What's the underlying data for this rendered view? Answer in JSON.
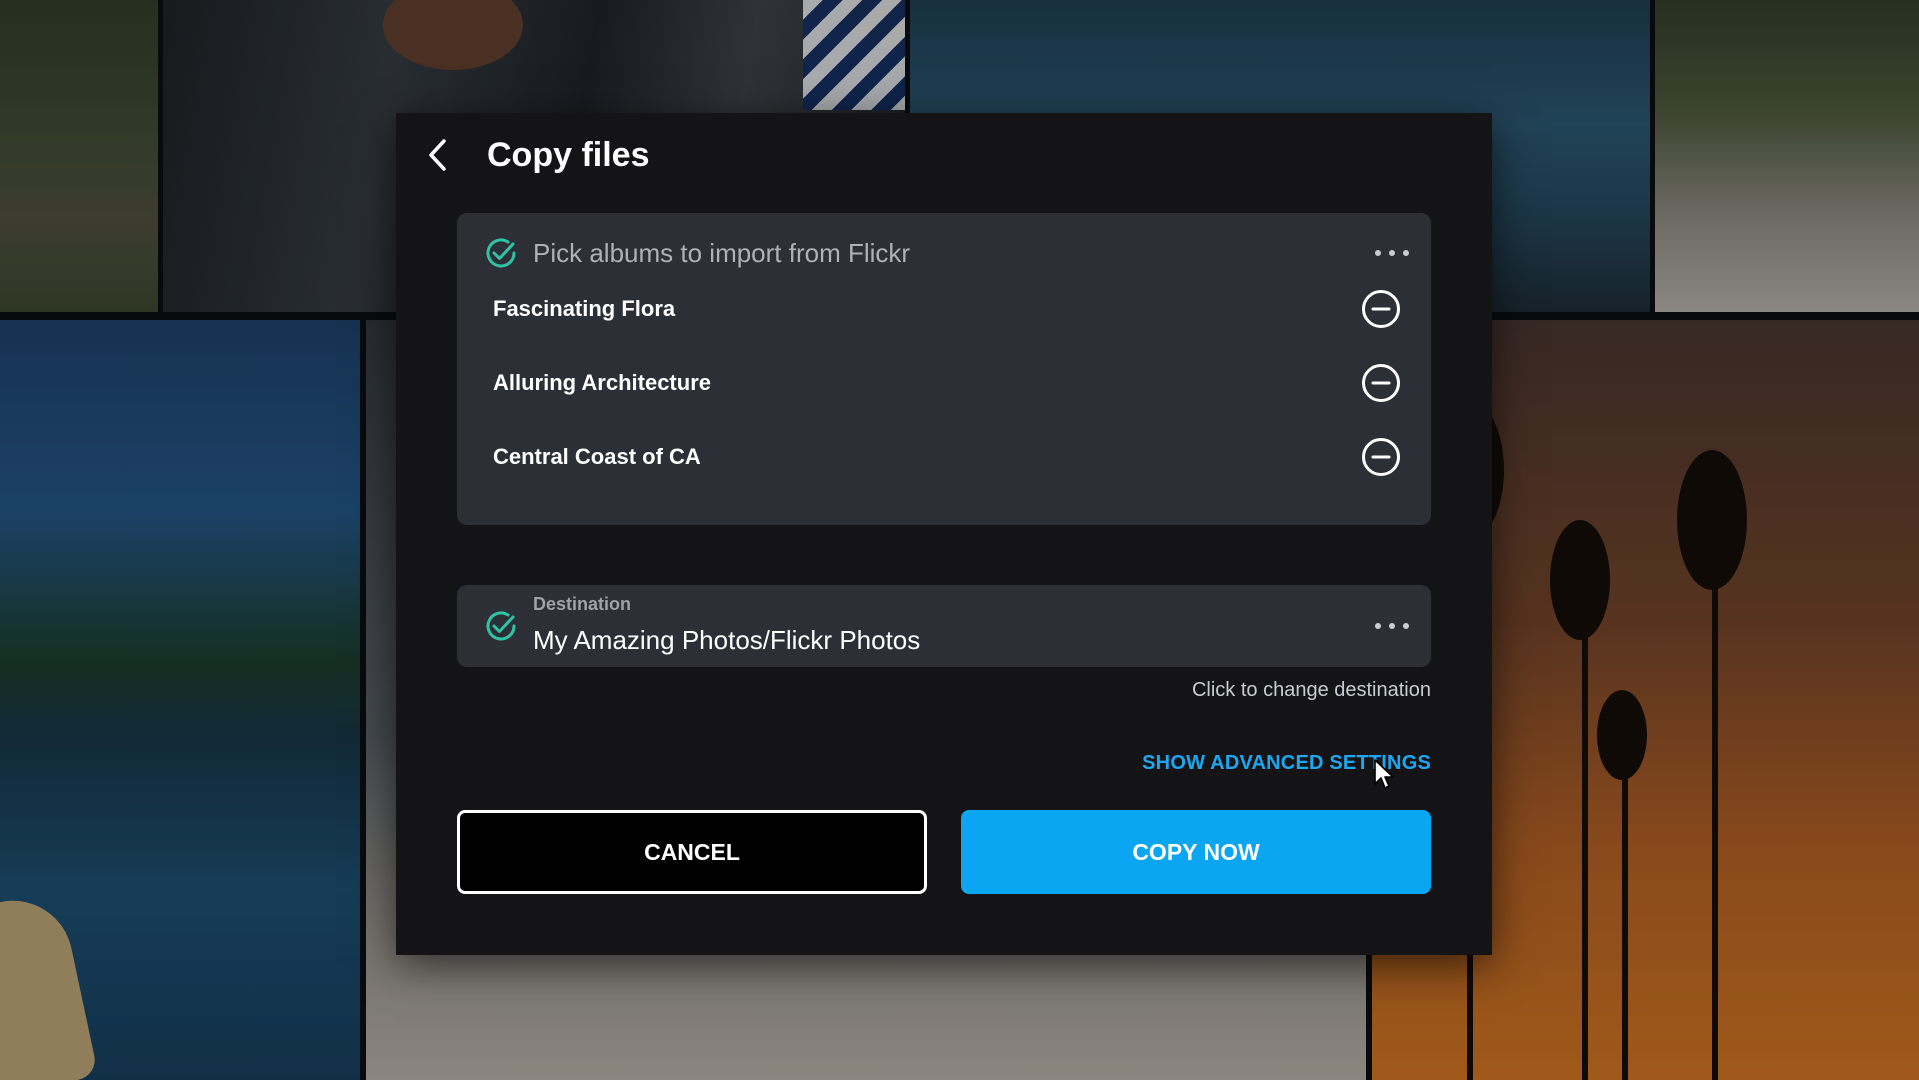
{
  "modal": {
    "title": "Copy files",
    "back_icon": "chevron-left-icon"
  },
  "albums_section": {
    "heading": "Pick albums to import from Flickr",
    "status_icon": "check-circle-icon",
    "more_icon": "more-horizontal-icon",
    "items": [
      {
        "label": "Fascinating Flora",
        "action_icon": "minus-circle-icon"
      },
      {
        "label": "Alluring Architecture",
        "action_icon": "minus-circle-icon"
      },
      {
        "label": "Central Coast of CA",
        "action_icon": "minus-circle-icon"
      }
    ]
  },
  "destination_section": {
    "label": "Destination",
    "value": "My Amazing Photos/Flickr Photos",
    "hint": "Click to change destination",
    "status_icon": "check-circle-icon",
    "more_icon": "more-horizontal-icon"
  },
  "advanced_link": "SHOW ADVANCED SETTINGS",
  "buttons": {
    "cancel": "CANCEL",
    "copy_now": "COPY NOW"
  },
  "colors": {
    "accent": "#0aa6f2",
    "check": "#2ec4a6",
    "modal_bg": "#141416",
    "card_bg": "#2c2f35"
  }
}
